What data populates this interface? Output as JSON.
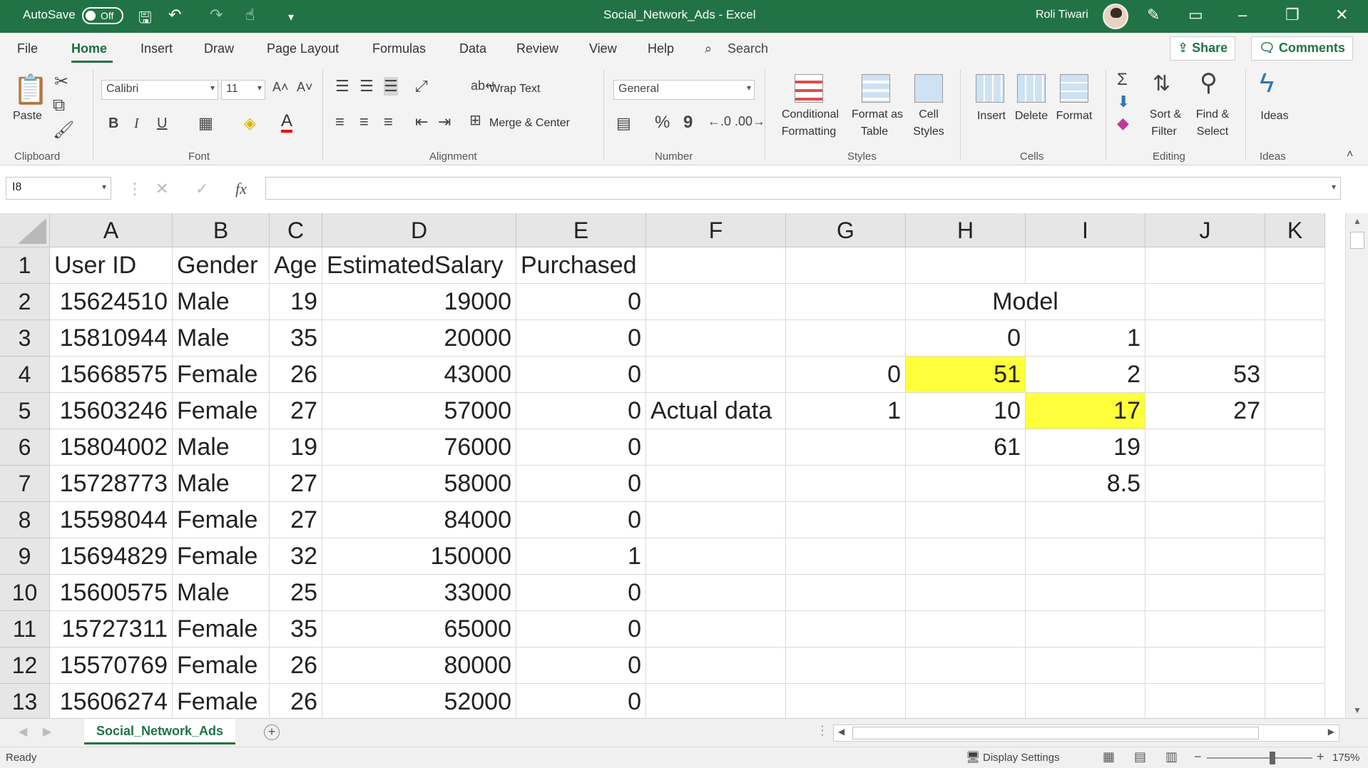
{
  "titlebar": {
    "autosave_label": "AutoSave",
    "autosave_state": "Off",
    "document_title": "Social_Network_Ads  -  Excel",
    "user_name": "Roli Tiwari"
  },
  "tabs": {
    "file": "File",
    "home": "Home",
    "insert": "Insert",
    "draw": "Draw",
    "page_layout": "Page Layout",
    "formulas": "Formulas",
    "data": "Data",
    "review": "Review",
    "view": "View",
    "help": "Help",
    "search": "Search",
    "share": "Share",
    "comments": "Comments"
  },
  "ribbon": {
    "clipboard": {
      "paste": "Paste",
      "group": "Clipboard"
    },
    "font": {
      "name": "Calibri",
      "size": "11",
      "bold": "B",
      "italic": "I",
      "underline": "U",
      "group": "Font"
    },
    "alignment": {
      "wrap_text": "Wrap Text",
      "merge_center": "Merge & Center",
      "group": "Alignment"
    },
    "number": {
      "format": "General",
      "percent": "%",
      "comma": "9",
      "group": "Number"
    },
    "styles": {
      "conditional_1": "Conditional",
      "conditional_2": "Formatting",
      "format_as_1": "Format as",
      "format_as_2": "Table",
      "cell_1": "Cell",
      "cell_2": "Styles",
      "group": "Styles"
    },
    "cells": {
      "insert": "Insert",
      "delete": "Delete",
      "format": "Format",
      "group": "Cells"
    },
    "editing": {
      "sort_1": "Sort &",
      "sort_2": "Filter",
      "find_1": "Find &",
      "find_2": "Select",
      "group": "Editing"
    },
    "ideas": {
      "label": "Ideas",
      "group": "Ideas"
    }
  },
  "formula_bar": {
    "name_box": "I8",
    "fx": "fx",
    "formula": ""
  },
  "columns": [
    "A",
    "B",
    "C",
    "D",
    "E",
    "F",
    "G",
    "H",
    "I",
    "J",
    "K"
  ],
  "rows": [
    "1",
    "2",
    "3",
    "4",
    "5",
    "6",
    "7",
    "8",
    "9",
    "10",
    "11",
    "12",
    "13"
  ],
  "cells": {
    "A1": "User ID",
    "B1": "Gender",
    "C1": "Age",
    "D1": "EstimatedSalary",
    "E1": "Purchased",
    "A2": "15624510",
    "B2": "Male",
    "C2": "19",
    "D2": "19000",
    "E2": "0",
    "A3": "15810944",
    "B3": "Male",
    "C3": "35",
    "D3": "20000",
    "E3": "0",
    "A4": "15668575",
    "B4": "Female",
    "C4": "26",
    "D4": "43000",
    "E4": "0",
    "A5": "15603246",
    "B5": "Female",
    "C5": "27",
    "D5": "57000",
    "E5": "0",
    "A6": "15804002",
    "B6": "Male",
    "C6": "19",
    "D6": "76000",
    "E6": "0",
    "A7": "15728773",
    "B7": "Male",
    "C7": "27",
    "D7": "58000",
    "E7": "0",
    "A8": "15598044",
    "B8": "Female",
    "C8": "27",
    "D8": "84000",
    "E8": "0",
    "A9": "15694829",
    "B9": "Female",
    "C9": "32",
    "D9": "150000",
    "E9": "1",
    "A10": "15600575",
    "B10": "Male",
    "C10": "25",
    "D10": "33000",
    "E10": "0",
    "A11": "15727311",
    "B11": "Female",
    "C11": "35",
    "D11": "65000",
    "E11": "0",
    "A12": "15570769",
    "B12": "Female",
    "C12": "26",
    "D12": "80000",
    "E12": "0",
    "A13": "15606274",
    "B13": "Female",
    "C13": "26",
    "D13": "52000",
    "E13": "0",
    "H2I2": "Model",
    "H3": "0",
    "I3": "1",
    "G4": "0",
    "H4": "51",
    "I4": "2",
    "J4": "53",
    "F5": "Actual data",
    "G5": "1",
    "H5": "10",
    "I5": "17",
    "J5": "27",
    "H6": "61",
    "I6": "19",
    "I7": "8.5"
  },
  "highlight_color": "#ffff3b",
  "sheet_tab": "Social_Network_Ads",
  "status": {
    "ready": "Ready",
    "display_settings": "Display Settings",
    "zoom": "175%"
  }
}
